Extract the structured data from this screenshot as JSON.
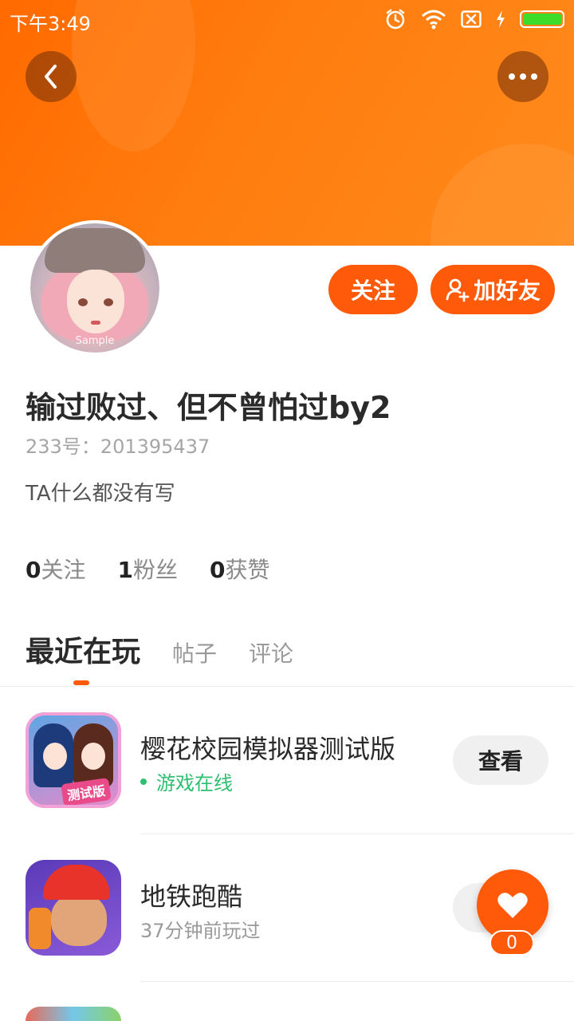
{
  "status_bar": {
    "time": "下午3:49",
    "icons": [
      "alarm-icon",
      "wifi-icon",
      "no-sim-icon",
      "charging-icon",
      "battery-icon"
    ],
    "battery_color": "#3ddc2a"
  },
  "header": {
    "back_icon": "chevron-left-icon",
    "more_icon": "more-dots-icon",
    "gradient_colors": [
      "#ff6a00",
      "#ff8a1c"
    ]
  },
  "profile": {
    "avatar_watermark": "Sample",
    "follow_label": "关注",
    "add_friend_label": "加好友",
    "username": "输过败过、但不曾怕过by2",
    "id_text": "233号：201395437",
    "bio": "TA什么都没有写"
  },
  "stats": [
    {
      "num": "0",
      "label": "关注"
    },
    {
      "num": "1",
      "label": "粉丝"
    },
    {
      "num": "0",
      "label": "获赞"
    }
  ],
  "tabs": [
    {
      "label": "最近在玩",
      "active": true
    },
    {
      "label": "帖子",
      "active": false
    },
    {
      "label": "评论",
      "active": false
    }
  ],
  "games": [
    {
      "name": "樱花校园模拟器测试版",
      "status": "游戏在线",
      "online": true,
      "action": "查看",
      "icon_badge": "测试版"
    },
    {
      "name": "地铁跑酷",
      "status": "37分钟前玩过",
      "online": false,
      "action": "查看"
    }
  ],
  "fab": {
    "icon": "heart-icon",
    "count": "0"
  },
  "colors": {
    "accent": "#ff5a0a",
    "online": "#2fbf71"
  }
}
